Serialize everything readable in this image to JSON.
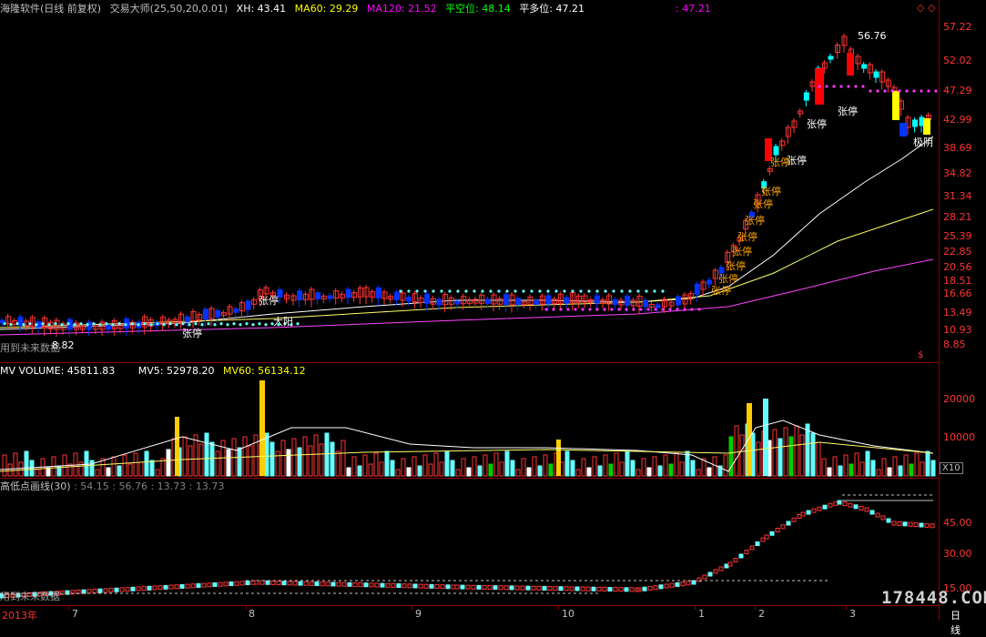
{
  "main_header": {
    "title": "海隆软件(日线 前复权)",
    "indicator": "交易大师(25,50,20,0.01)",
    "xh": "XH: 43.41",
    "ma60": "MA60: 29.29",
    "ma120": "MA120: 21.52",
    "pkw": "平空位: 48.14",
    "pdw": "平多位: 47.21",
    "extra": ": 47.21",
    "colors": {
      "title": "#c0c0c0",
      "xh": "#ffffff",
      "ma60": "#ffff00",
      "ma120": "#ff00ff",
      "pkw": "#00ff00",
      "pdw": "#ffffff",
      "extra": "#ff00ff"
    }
  },
  "vol_header": {
    "mv": "MV VOLUME: 45811.83",
    "mv5": "MV5: 52978.20",
    "mv60": "MV60: 56134.12"
  },
  "hl_header": {
    "name": "高低点画线(30)",
    "values": ": 54.15 : 56.76 : 13.73 : 13.73"
  },
  "price_axis": [
    "57.22",
    "52.02",
    "47.29",
    "42.99",
    "38.69",
    "34.82",
    "31.34",
    "28.21",
    "25.39",
    "22.85",
    "20.56",
    "18.51",
    "16.66",
    "13.49",
    "10.93",
    "8.85"
  ],
  "vol_axis": [
    "20000",
    "10000"
  ],
  "vol_unit": "X10",
  "hl_axis": [
    "45.00",
    "30.00",
    "15.00"
  ],
  "time_axis": [
    "2013年",
    "7",
    "8",
    "9",
    "10",
    "1",
    "2",
    "3",
    "日线"
  ],
  "annotations": {
    "high": "56.76",
    "low": "8.82",
    "limit_up": "张停",
    "big_yang": "大阳",
    "extreme": "极阴",
    "future": "用到未来数据"
  },
  "watermark": "178448.COM",
  "icons": [
    "diamond-icon",
    "diamond-icon",
    "dollar-icon"
  ]
}
